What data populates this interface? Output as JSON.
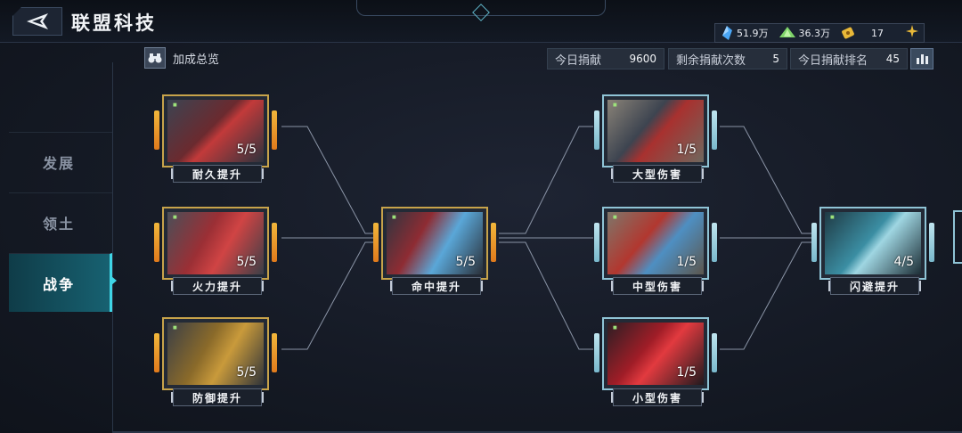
{
  "header": {
    "title": "联盟科技",
    "back_icon": "back-arrow-icon"
  },
  "resources": [
    {
      "name": "blue-crystal-icon",
      "value": "51.9万",
      "color": "#4aa6f5"
    },
    {
      "name": "green-crystal-icon",
      "value": "36.3万",
      "color": "#7fd46a"
    },
    {
      "name": "gold-ticket-icon",
      "value": "17",
      "color": "#e8b838"
    }
  ],
  "bonus_overview": {
    "label": "加成总览",
    "icon": "binoculars-icon"
  },
  "stats": {
    "today_donation": {
      "label": "今日捐献",
      "value": "9600"
    },
    "remaining_donations": {
      "label": "剩余捐献次数",
      "value": "5"
    },
    "today_rank": {
      "label": "今日捐献排名",
      "value": "45"
    }
  },
  "sidebar": {
    "items": [
      {
        "label": "发展",
        "active": false
      },
      {
        "label": "领土",
        "active": false
      },
      {
        "label": "战争",
        "active": true
      }
    ]
  },
  "tech_nodes": [
    {
      "id": "durability",
      "label": "耐久提升",
      "level": "5/5",
      "maxed": true
    },
    {
      "id": "firepower",
      "label": "火力提升",
      "level": "5/5",
      "maxed": true
    },
    {
      "id": "defense",
      "label": "防御提升",
      "level": "5/5",
      "maxed": true
    },
    {
      "id": "accuracy",
      "label": "命中提升",
      "level": "5/5",
      "maxed": true
    },
    {
      "id": "large-damage",
      "label": "大型伤害",
      "level": "1/5",
      "maxed": false
    },
    {
      "id": "medium-damage",
      "label": "中型伤害",
      "level": "1/5",
      "maxed": false
    },
    {
      "id": "small-damage",
      "label": "小型伤害",
      "level": "1/5",
      "maxed": false
    },
    {
      "id": "evasion",
      "label": "闪避提升",
      "level": "4/5",
      "maxed": false
    }
  ],
  "colors": {
    "maxed_frame": "#c7a34a",
    "normal_frame": "#8fc4d6",
    "active_tab": "#176171",
    "accent": "#3fd5e6"
  }
}
